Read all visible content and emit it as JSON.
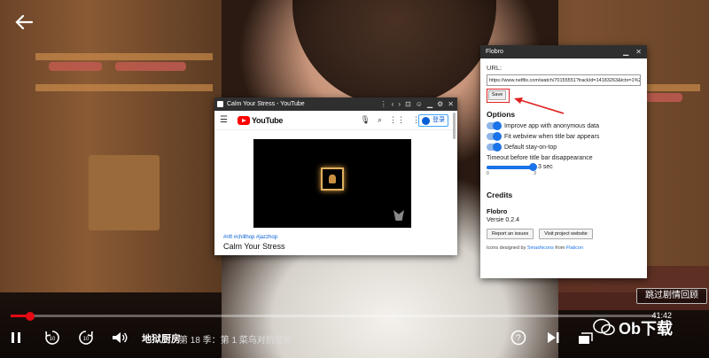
{
  "player": {
    "back_icon": "arrow-left-icon",
    "skip_button": "跳过剧情回顾",
    "time_remaining": "41:42",
    "progress_fraction": 0.03,
    "show_title": "地狱厨房",
    "episode_info": "第 18 季：第 1 菜鸟对抗老将",
    "colors": {
      "progress": "#e50914"
    }
  },
  "youtube_window": {
    "window_title": "Calm Your Stress - YouTube",
    "logo_text": "YouTube",
    "signin_label": "登录",
    "tags": "#nft #chillhop #jazzhop",
    "video_title": "Calm Your Stress"
  },
  "flobro": {
    "window_title": "Flobro",
    "url_label": "URL:",
    "url_value": "https://www.netflix.com/watch/70155551?trackId=14183263&tctx=1%2C0%",
    "save_label": "Save",
    "options_heading": "Options",
    "options": [
      {
        "label": "Improve app with anonymous data",
        "on": true
      },
      {
        "label": "Fit webview when title bar appears",
        "on": true
      },
      {
        "label": "Default stay-on-top",
        "on": true
      }
    ],
    "timeout_label": "Timeout before title bar disappearance",
    "timeout_value": "3 sec",
    "timeout_min": "0",
    "timeout_max": "3",
    "timeout_fraction": 1.0,
    "credits_heading": "Credits",
    "app_name": "Flobro",
    "version": "Versie 0.2.4",
    "report_button": "Report an issues",
    "project_button": "Visit project website",
    "icons_prefix": "Icons designed by",
    "icons_author": "Smashicons",
    "icons_from": "from",
    "icons_site": "Flaticon"
  },
  "watermark": {
    "label": "Ob下载"
  }
}
